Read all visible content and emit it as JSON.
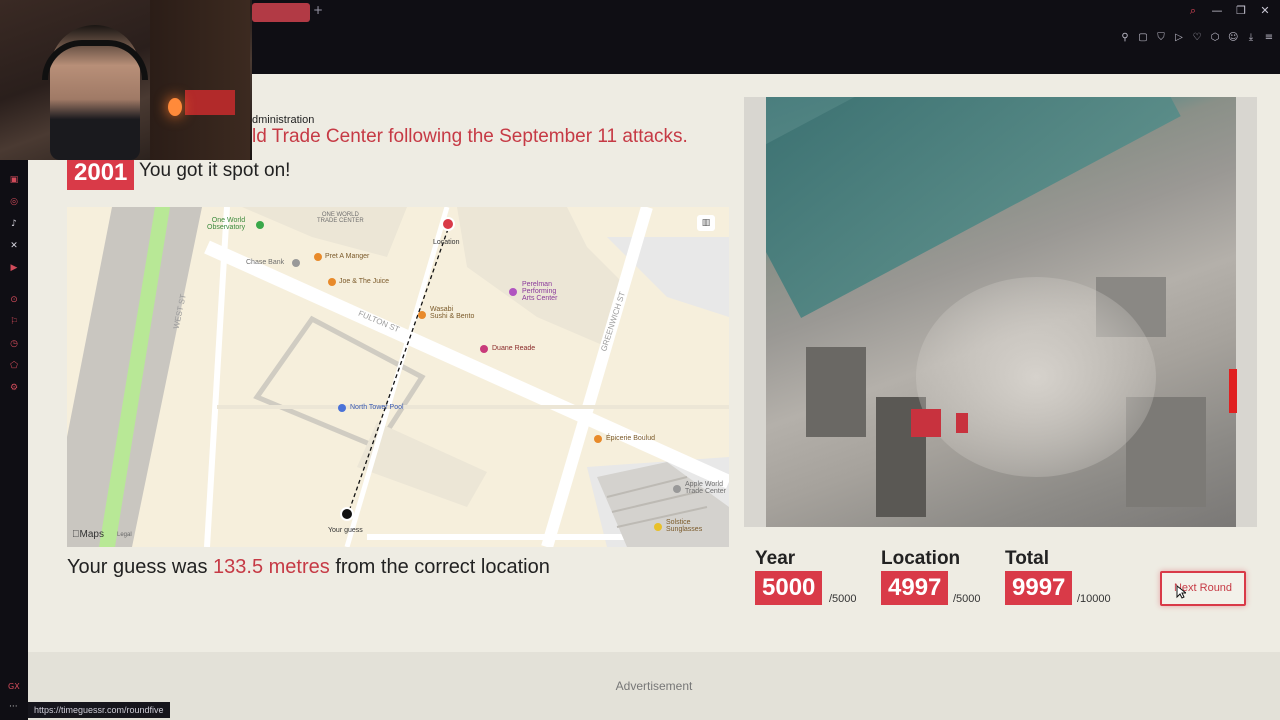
{
  "browser": {
    "new_tab_glyph": "+",
    "status_url": "https://timeguessr.com/roundfive",
    "sidebar_icons": [
      "twitch-icon",
      "instagram-icon",
      "tiktok-icon",
      "x-icon",
      "youtube-icon",
      "play-icon",
      "bookmark-icon",
      "clock-icon",
      "extensions-icon",
      "settings-icon"
    ],
    "gx_label": "GX"
  },
  "event": {
    "admin_text": "dministration",
    "headline": "ld Trade Center following the September 11 attacks.",
    "year": "2001",
    "feedback": "You got it spot on!"
  },
  "map": {
    "labels": {
      "owtc": "ONE WORLD\nTRADE CENTER",
      "one_world_observatory": "One World\nObservatory",
      "location": "Location",
      "chase_bank": "Chase Bank",
      "pret": "Pret A Manger",
      "joe": "Joe & The Juice",
      "wasabi": "Wasabi\nSushi & Bento",
      "perelman": "Perelman\nPerforming\nArts Center",
      "duane": "Duane Reade",
      "north_pool": "North Tower Pool",
      "epicerie": "Épicerie Boulud",
      "apple": "Apple World\nTrade Center",
      "solstice": "Solstice\nSunglasses",
      "your_guess": "Your guess",
      "west_st": "WEST ST",
      "fulton_st": "FULTON ST",
      "greenwich_st": "GREENWICH ST",
      "maps_logo": "Maps",
      "legal": "Legal"
    }
  },
  "result": {
    "prefix": "Your guess was",
    "distance": "133.5 metres",
    "suffix": "from the correct location"
  },
  "scores": {
    "year": {
      "label": "Year",
      "value": "5000",
      "max": "/5000"
    },
    "location": {
      "label": "Location",
      "value": "4997",
      "max": "/5000"
    },
    "total": {
      "label": "Total",
      "value": "9997",
      "max": "/10000"
    }
  },
  "next_round": "Next Round",
  "advertisement": "Advertisement",
  "colors": {
    "accent": "#d93a48",
    "page_bg": "#eeece3",
    "chrome_bg": "#0f0e14"
  }
}
